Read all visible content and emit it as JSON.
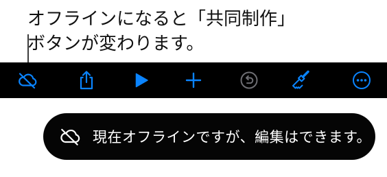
{
  "callout": {
    "line1": "オフラインになると「共同制作」",
    "line2": "ボタンが変わります。"
  },
  "toolbar": {
    "background": "#000000",
    "accent": "#0a84ff",
    "disabled": "#6e6e73",
    "buttons": [
      {
        "icon": "cloud-offline-icon",
        "state": "enabled"
      },
      {
        "icon": "share-icon",
        "state": "enabled"
      },
      {
        "icon": "play-icon",
        "state": "enabled"
      },
      {
        "icon": "add-icon",
        "state": "enabled"
      },
      {
        "icon": "undo-icon",
        "state": "disabled"
      },
      {
        "icon": "format-brush-icon",
        "state": "enabled"
      },
      {
        "icon": "more-icon",
        "state": "enabled"
      }
    ]
  },
  "toast": {
    "icon": "cloud-offline-icon",
    "message": "現在オフラインですが、編集はできます。"
  }
}
